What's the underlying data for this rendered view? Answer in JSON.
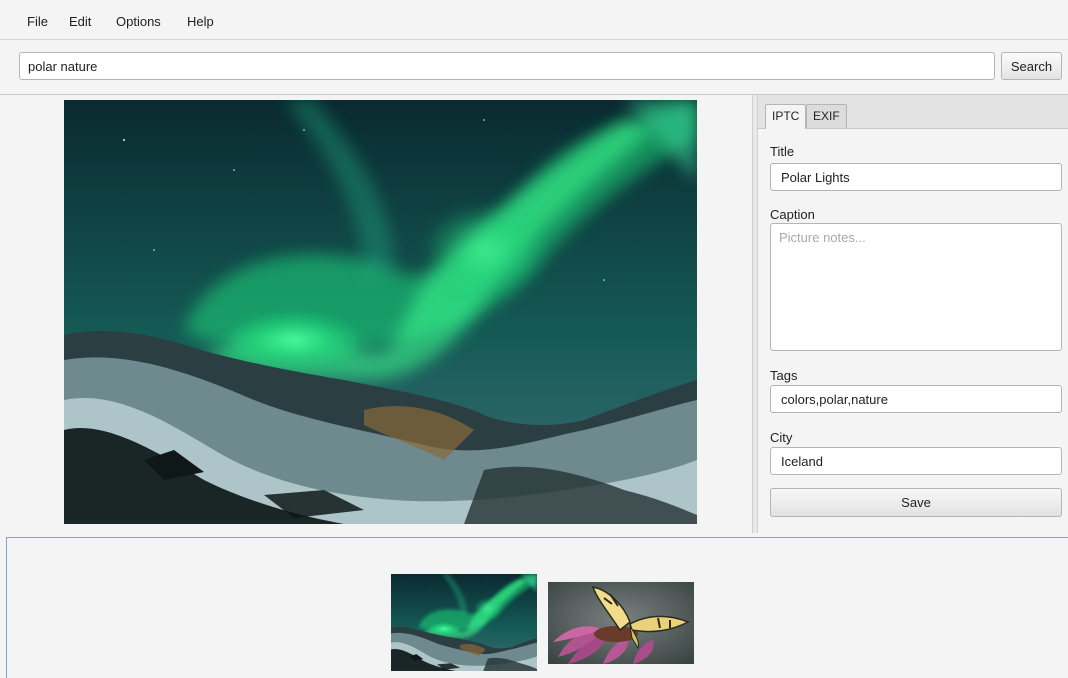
{
  "menu": {
    "items": [
      "File",
      "Edit",
      "Options",
      "Help"
    ]
  },
  "search": {
    "value": "polar nature",
    "button_label": "Search"
  },
  "tabs": [
    {
      "label": "IPTC",
      "active": true
    },
    {
      "label": "EXIF",
      "active": false
    }
  ],
  "metadata": {
    "title_label": "Title",
    "title_value": "Polar Lights",
    "caption_label": "Caption",
    "caption_placeholder": "Picture notes...",
    "tags_label": "Tags",
    "tags_value": "colors,polar,nature",
    "city_label": "City",
    "city_value": "Iceland",
    "save_label": "Save"
  },
  "thumbnails": [
    {
      "name": "aurora-thumbnail"
    },
    {
      "name": "butterfly-thumbnail"
    }
  ],
  "colors": {
    "aurora_green": "#1fd57a",
    "sky_dark": "#0f2e33",
    "strip_border": "#79a8c0"
  }
}
